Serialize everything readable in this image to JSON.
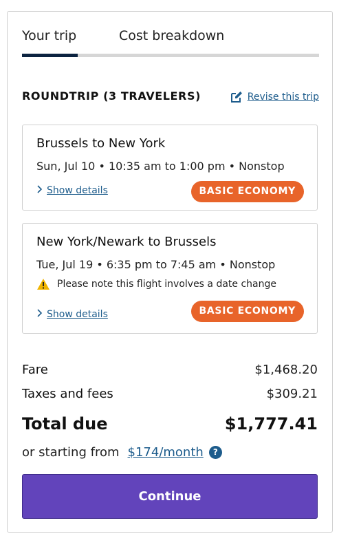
{
  "tabs": {
    "your_trip": "Your trip",
    "cost_breakdown": "Cost breakdown",
    "active": "your_trip"
  },
  "trip": {
    "title": "ROUNDTRIP (3 TRAVELERS)",
    "revise_label": "Revise this trip"
  },
  "flights": [
    {
      "route": "Brussels to New York",
      "times": "Sun, Jul 10 • 10:35 am to 1:00 pm • Nonstop",
      "details_label": "Show details",
      "fare_class": "BASIC ECONOMY"
    },
    {
      "route": "New York/Newark to Brussels",
      "times": "Tue, Jul 19 • 6:35 pm to 7:45 am • Nonstop",
      "warning": "Please note this flight involves a date change",
      "details_label": "Show details",
      "fare_class": "BASIC ECONOMY"
    }
  ],
  "pricing": {
    "fare_label": "Fare",
    "fare_amount": "$1,468.20",
    "taxes_label": "Taxes and fees",
    "taxes_amount": "$309.21",
    "total_label": "Total due",
    "total_amount": "$1,777.41",
    "starting_prefix": "or starting from",
    "monthly_link": "$174/month",
    "help_glyph": "?"
  },
  "cta": {
    "continue_label": "Continue"
  },
  "colors": {
    "brand_navy": "#0c2340",
    "link_blue": "#1d5c8c",
    "badge_orange": "#e8642a",
    "cta_purple": "#6244bb",
    "warning_yellow": "#f0b400"
  },
  "icons": {
    "revise": "edit-icon",
    "warning": "warning-icon",
    "chevron": "chevron-right-icon",
    "help": "help-icon"
  }
}
